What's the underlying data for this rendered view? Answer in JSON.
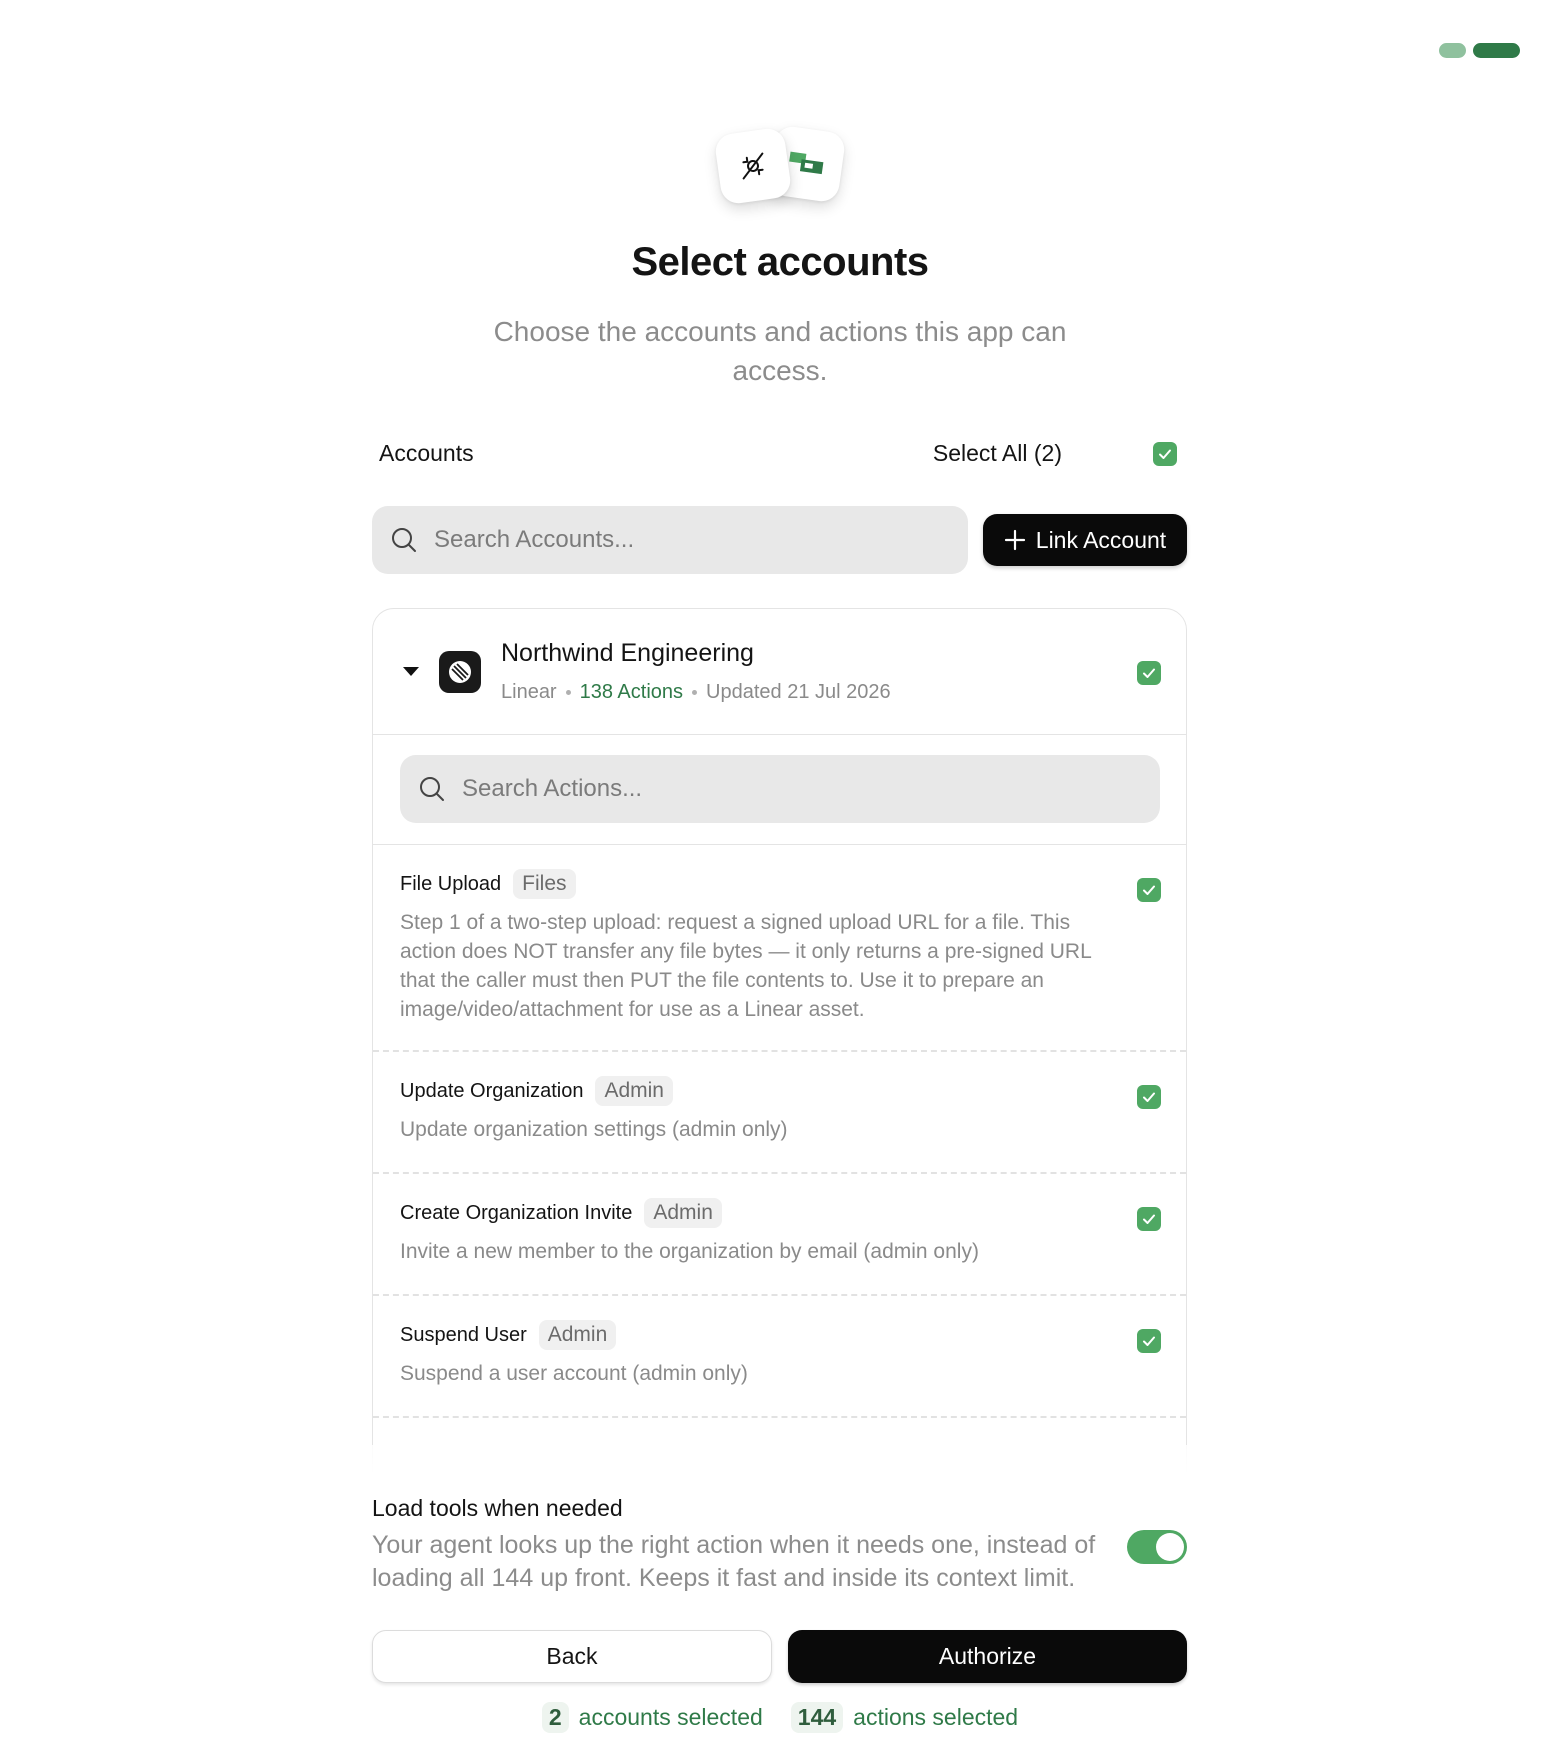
{
  "stepper": {
    "current": 2,
    "total": 2
  },
  "header": {
    "icons": [
      "plug-icon",
      "linear-brand-icon"
    ],
    "title": "Select accounts",
    "subtitle": "Choose the accounts and actions this app can access."
  },
  "accounts": {
    "label": "Accounts",
    "select_all_label": "Select All (2)",
    "select_all_checked": true,
    "search_placeholder": "Search Accounts...",
    "link_button_label": "Link Account"
  },
  "account": {
    "name": "Northwind Engineering",
    "provider": "Linear",
    "actions_count": "138 Actions",
    "updated": "Updated 21 Jul 2026",
    "checked": true,
    "expanded": true,
    "actions_search_placeholder": "Search Actions..."
  },
  "actions": [
    {
      "name": "File Upload",
      "tag": "Files",
      "description": "Step 1 of a two-step upload: request a signed upload URL for a file. This action does NOT transfer any file bytes — it only returns a pre-signed URL that the caller must then PUT the file contents to. Use it to prepare an image/video/attachment for use as a Linear asset.",
      "checked": true
    },
    {
      "name": "Update Organization",
      "tag": "Admin",
      "description": "Update organization settings (admin only)",
      "checked": true
    },
    {
      "name": "Create Organization Invite",
      "tag": "Admin",
      "description": "Invite a new member to the organization by email (admin only)",
      "checked": true
    },
    {
      "name": "Suspend User",
      "tag": "Admin",
      "description": "Suspend a user account (admin only)",
      "checked": true
    }
  ],
  "footer": {
    "toggle_title": "Load tools when needed",
    "toggle_description": "Your agent looks up the right action when it needs one, instead of loading all 144 up front. Keeps it fast and inside its context limit.",
    "toggle_on": true,
    "back_label": "Back",
    "authorize_label": "Authorize",
    "accounts_selected_count": "2",
    "accounts_selected_label": "accounts selected",
    "actions_selected_count": "144",
    "actions_selected_label": "actions selected"
  },
  "colors": {
    "accent": "#4fa863",
    "accent_dark": "#2f7a48",
    "primary_button": "#0a0a0a"
  }
}
